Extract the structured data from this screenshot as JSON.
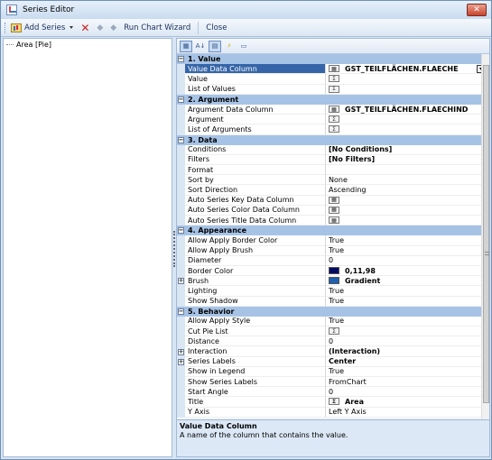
{
  "window": {
    "title": "Series Editor",
    "close": "✕"
  },
  "toolbar": {
    "add_series": "Add Series",
    "run_chart_wizard": "Run Chart Wizard",
    "close": "Close"
  },
  "tree": {
    "items": [
      "Area [Pie]"
    ]
  },
  "categories": [
    {
      "label": "1. Value",
      "rows": [
        {
          "name": "Value Data Column",
          "value": "GST_TEILFLÄCHEN.FLAECHE",
          "icon": "abc",
          "bold": true,
          "selected": true,
          "dropdown": true
        },
        {
          "name": "Value",
          "value": "",
          "icon": "Σ"
        },
        {
          "name": "List of Values",
          "value": "",
          "icon": "Σ"
        }
      ]
    },
    {
      "label": "2. Argument",
      "rows": [
        {
          "name": "Argument Data Column",
          "value": "GST_TEILFLÄCHEN.FLAECHIND",
          "icon": "abc",
          "bold": true
        },
        {
          "name": "Argument",
          "value": "",
          "icon": "Σ"
        },
        {
          "name": "List of Arguments",
          "value": "",
          "icon": "Σ"
        }
      ]
    },
    {
      "label": "3. Data",
      "rows": [
        {
          "name": "Conditions",
          "value": "[No Conditions]",
          "bold": true
        },
        {
          "name": "Filters",
          "value": "[No Filters]",
          "bold": true
        },
        {
          "name": "Format",
          "value": ""
        },
        {
          "name": "Sort by",
          "value": "None"
        },
        {
          "name": "Sort Direction",
          "value": "Ascending"
        },
        {
          "name": "Auto Series Key Data Column",
          "value": "",
          "icon": "abc"
        },
        {
          "name": "Auto Series Color Data Column",
          "value": "",
          "icon": "abc"
        },
        {
          "name": "Auto Series Title Data Column",
          "value": "",
          "icon": "abc"
        }
      ]
    },
    {
      "label": "4. Appearance",
      "rows": [
        {
          "name": "Allow Apply Border Color",
          "value": "True"
        },
        {
          "name": "Allow Apply Brush",
          "value": "True"
        },
        {
          "name": "Diameter",
          "value": "0"
        },
        {
          "name": "Border Color",
          "value": "0,11,98",
          "swatch": "#000b62",
          "bold": true
        },
        {
          "name": "Brush",
          "value": "Gradient",
          "swatch": "#1f5fae",
          "bold": true,
          "expand": true
        },
        {
          "name": "Lighting",
          "value": "True"
        },
        {
          "name": "Show Shadow",
          "value": "True"
        }
      ]
    },
    {
      "label": "5. Behavior",
      "rows": [
        {
          "name": "Allow Apply Style",
          "value": "True"
        },
        {
          "name": "Cut Pie List",
          "value": "",
          "icon": "Σ"
        },
        {
          "name": "Distance",
          "value": "0"
        },
        {
          "name": "Interaction",
          "value": "(Interaction)",
          "bold": true,
          "expand": true
        },
        {
          "name": "Series Labels",
          "value": "Center",
          "bold": true,
          "expand": true
        },
        {
          "name": "Show in Legend",
          "value": "True"
        },
        {
          "name": "Show Series Labels",
          "value": "FromChart"
        },
        {
          "name": "Start Angle",
          "value": "0"
        },
        {
          "name": "Title",
          "value": "Area",
          "icon": "Σ",
          "bold": true
        },
        {
          "name": "Y Axis",
          "value": "Left Y Axis"
        }
      ]
    }
  ],
  "description": {
    "title": "Value Data Column",
    "text": "A name of the column that contains the value."
  }
}
